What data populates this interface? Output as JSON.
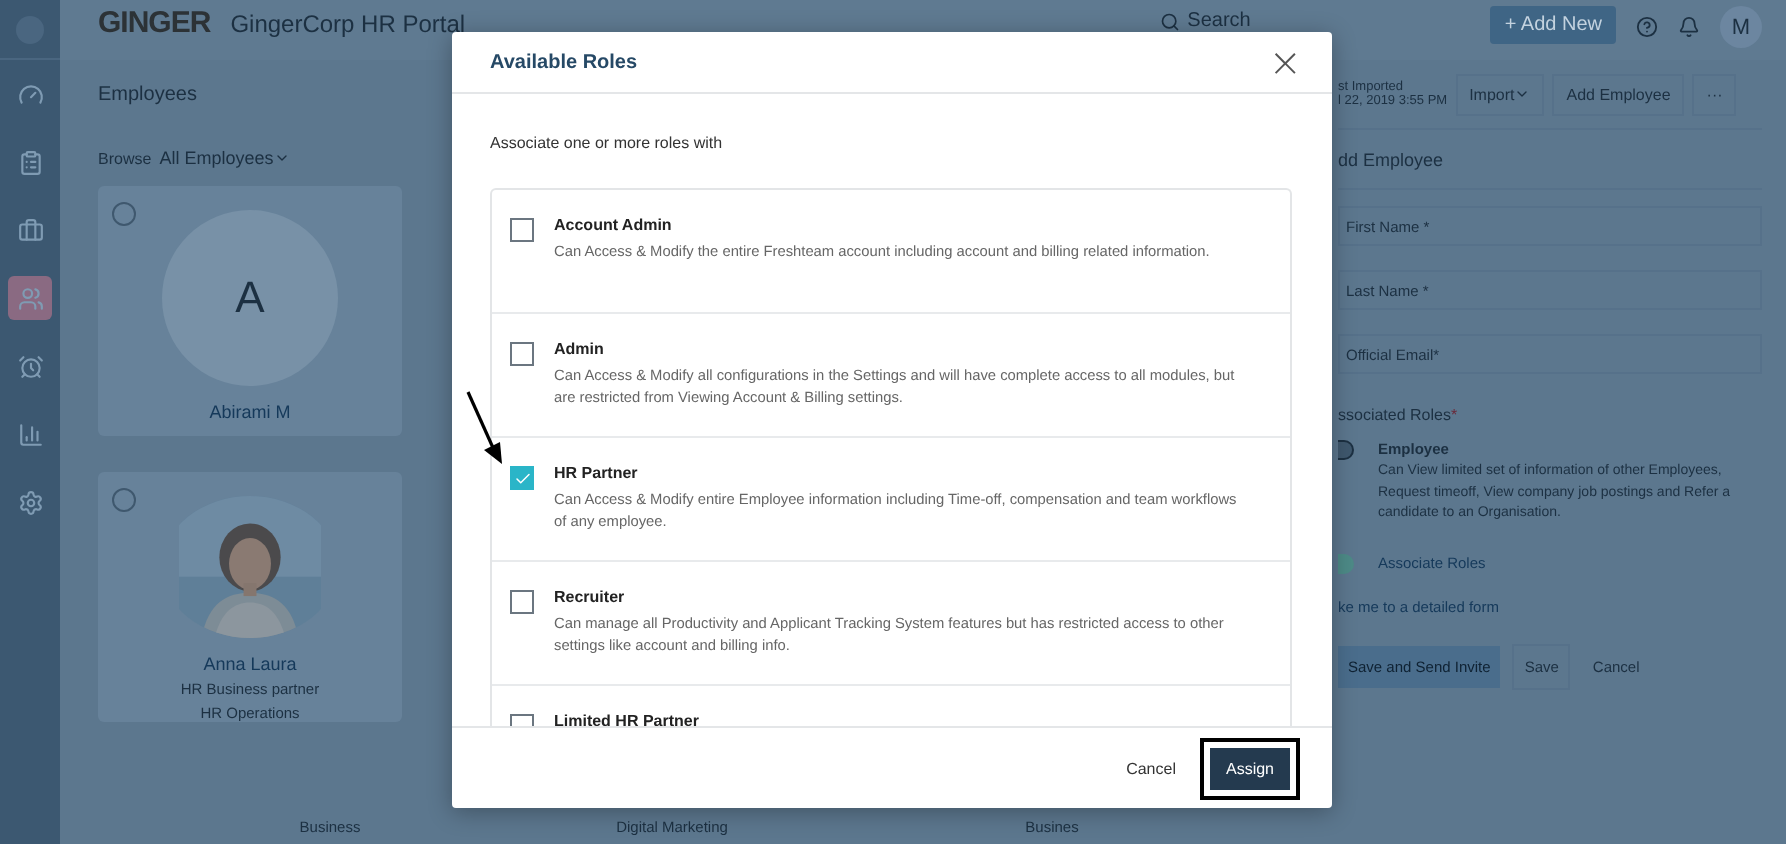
{
  "app": {
    "logo": "GINGER",
    "title": "GingerCorp HR Portal",
    "search": {
      "placeholder": "Search"
    },
    "add_new": "+ Add New",
    "avatar": "M"
  },
  "sidebar": {
    "items": [
      {
        "kind": "dashboard",
        "selected": false
      },
      {
        "kind": "tasks",
        "selected": false
      },
      {
        "kind": "jobs",
        "selected": false
      },
      {
        "kind": "employees",
        "selected": true
      },
      {
        "kind": "timeoff",
        "selected": false
      },
      {
        "kind": "reports",
        "selected": false
      },
      {
        "kind": "settings",
        "selected": false
      }
    ]
  },
  "employees": {
    "heading": "Employees",
    "browse_label": "Browse",
    "browse_value": "All Employees",
    "cards": [
      {
        "initial": "A",
        "name": "Abirami M",
        "selected": false
      },
      {
        "kind": "picture",
        "name": "Anna Laura",
        "role": "HR Business partner",
        "team": "HR Operations",
        "selected": false
      }
    ],
    "bottom_labels": [
      "Business",
      "Digital Marketing",
      "Busines"
    ]
  },
  "right_panel": {
    "imported_label": "st Imported",
    "imported_date": "l 22, 2019 3:55 PM",
    "import": "Import",
    "add_employee": "Add Employee",
    "more": "···",
    "form_title": "dd Employee",
    "fields": [
      {
        "placeholder": "First Name *"
      },
      {
        "placeholder": "Last Name *"
      },
      {
        "placeholder": "Official Email*"
      }
    ],
    "roles_label": "ssociated Roles",
    "required": "*",
    "role_selected": true,
    "role_name": "Employee",
    "role_desc": "Can View limited set of information of other Employees, Request timeoff, View company job postings and Refer a candidate to an Organisation.",
    "associate_roles": "Associate Roles",
    "detailed_link": "ke me to a detailed form",
    "buttons": [
      "Save and Send Invite",
      "Save",
      "Cancel"
    ]
  },
  "modal": {
    "title": "Available Roles",
    "close": "×",
    "intro": "Associate one or more roles with",
    "roles": [
      {
        "name": "Account Admin",
        "description": "Can Access & Modify the entire Freshteam account including account and billing related information.",
        "checked": false
      },
      {
        "name": "Admin",
        "description": "Can Access & Modify all configurations in the Settings and will have complete access to all modules, but are restricted from Viewing Account & Billing settings.",
        "checked": false
      },
      {
        "name": "HR Partner",
        "description": "Can Access & Modify entire Employee information including Time-off, compensation and team workflows of any employee.",
        "checked": true,
        "annotated": true
      },
      {
        "name": "Recruiter",
        "description": "Can manage all Productivity and Applicant Tracking System features but has restricted access to other settings like account and billing info.",
        "checked": false
      },
      {
        "name": "Limited HR Partner",
        "checked": false
      }
    ],
    "cancel": "Cancel",
    "assign": "Assign",
    "assign_highlighted": true
  }
}
